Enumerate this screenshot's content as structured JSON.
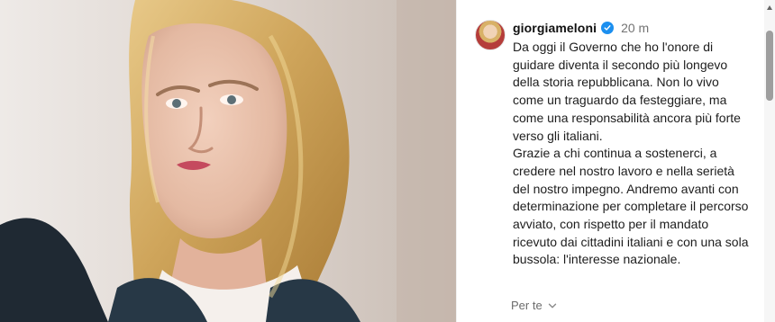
{
  "post": {
    "username": "giorgiameloni",
    "time": "20 m",
    "caption_lines": [
      "Da oggi il Governo che ho l'onore di guidare diventa il secondo più longevo della storia repubblicana. Non lo vivo come un traguardo da festeggiare, ma come una responsabilità ancora più forte verso gli italiani.",
      "Grazie a chi continua a sostenerci, a credere nel nostro lavoro e nella serietà del nostro impegno. Andremo avanti con determinazione per completare il percorso avviato, con rispetto per il mandato ricevuto dai cittadini italiani e con una sola bussola: l'interesse nazionale."
    ],
    "footer_label": "Per te"
  },
  "icons": {
    "verified": "verified-badge-icon",
    "chevron": "chevron-down-icon"
  },
  "colors": {
    "verified_blue": "#1c8fef",
    "text": "#1d1d1d",
    "muted": "#737373"
  }
}
